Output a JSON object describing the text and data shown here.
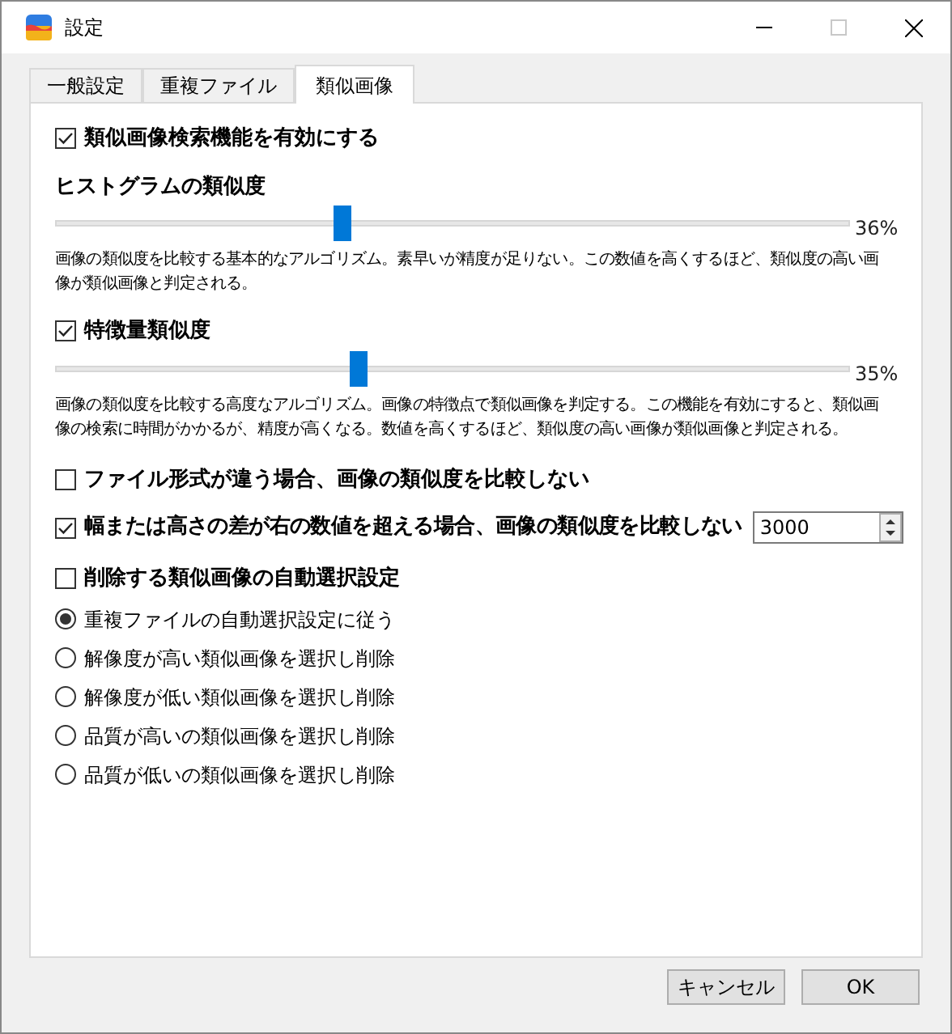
{
  "window": {
    "title": "設定"
  },
  "tabs": [
    {
      "label": "一般設定",
      "selected": false
    },
    {
      "label": "重複ファイル",
      "selected": false
    },
    {
      "label": "類似画像",
      "selected": true
    }
  ],
  "enable": {
    "label": "類似画像検索機能を有効にする",
    "checked": true
  },
  "histogram": {
    "title": "ヒストグラムの類似度",
    "level": 0.36,
    "reading": "36%",
    "description": "画像の類似度を比較する基本的なアルゴリズム。素早いが精度が足りない。この数値を高くするほど、類似度の高い画像が類似画像と判定される。"
  },
  "feature": {
    "label": "特徴量類似度",
    "checked": true,
    "level": 0.38,
    "reading": "35%",
    "description": "画像の類似度を比較する高度なアルゴリズム。画像の特徴点で類似画像を判定する。この機能を有効にすると、類似画像の検索に時間がかかるが、精度が高くなる。数値を高くするほど、類似度の高い画像が類似画像と判定される。"
  },
  "format_check": {
    "label": "ファイル形式が違う場合、画像の類似度を比較しない",
    "checked": false
  },
  "size_check": {
    "label": "幅または高さの差が右の数値を超える場合、画像の類似度を比較しない",
    "checked": true,
    "value": "3000"
  },
  "auto_select": {
    "label": "削除する類似画像の自動選択設定",
    "checked": false,
    "options": [
      {
        "label": "重複ファイルの自動選択設定に従う",
        "selected": true
      },
      {
        "label": "解像度が高い類似画像を選択し削除",
        "selected": false
      },
      {
        "label": "解像度が低い類似画像を選択し削除",
        "selected": false
      },
      {
        "label": "品質が高いの類似画像を選択し削除",
        "selected": false
      },
      {
        "label": "品質が低いの類似画像を選択し削除",
        "selected": false
      }
    ]
  },
  "buttons": [
    {
      "label": "キャンセル"
    },
    {
      "label": "OK"
    }
  ]
}
